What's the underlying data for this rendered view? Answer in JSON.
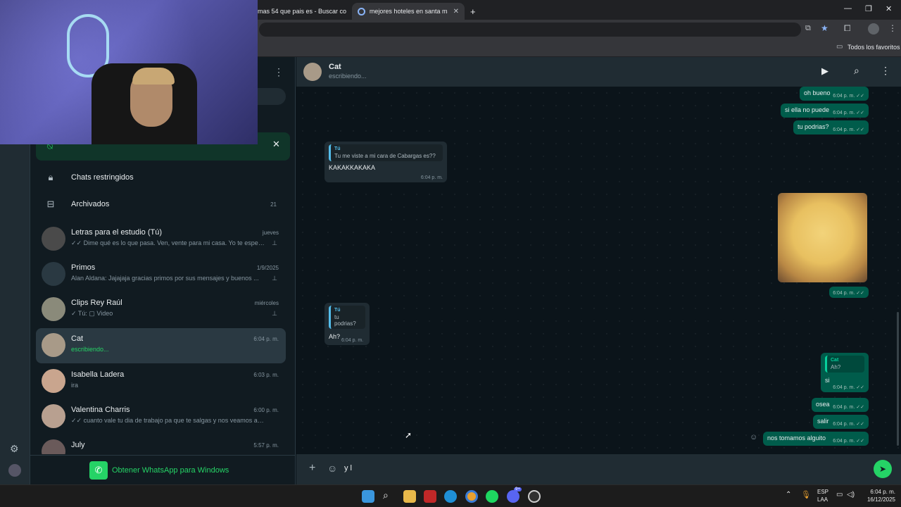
{
  "browser": {
    "tabs": [
      {
        "title": "mas 54 que pais es - Buscar co",
        "close": "✕"
      },
      {
        "title": "mejores hoteles en santa marta",
        "close": "✕"
      }
    ],
    "new_tab": "+",
    "window_controls": [
      "—",
      "❐",
      "✕"
    ],
    "bookmarks_label": "Todos los favoritos"
  },
  "sidebar": {
    "banner_close": "✕",
    "menu": [
      {
        "icon": "lock-icon",
        "label": "Chats restringidos",
        "count": ""
      },
      {
        "icon": "archive-icon",
        "label": "Archivados",
        "count": "21"
      }
    ],
    "chats": [
      {
        "name": "Letras para el estudio (Tú)",
        "time": "jueves",
        "preview": "✓✓ Dime qué es lo que pasa. Ven, vente para mi casa. Yo te esper...",
        "pinned": true
      },
      {
        "name": "Primos",
        "time": "1/9/2025",
        "preview": "Alan Aldana: Jajajaja gracias primos por sus mensajes y buenos ...",
        "pinned": true
      },
      {
        "name": "Clips Rey Raúl",
        "time": "miércoles",
        "preview": "✓ Tú: ▢ Video",
        "pinned": true
      },
      {
        "name": "Cat",
        "time": "6:04 p. m.",
        "preview": "escribiendo...",
        "typing": true
      },
      {
        "name": "Isabella  Ladera",
        "time": "6:03 p. m.",
        "preview": "ira"
      },
      {
        "name": "Valentina Charris",
        "time": "6:00 p. m.",
        "preview": "✓✓ cuanto vale tu dia de trabajo pa que te salgas y nos veamos ahori..."
      },
      {
        "name": "July",
        "time": "5:57 p. m.",
        "preview": ""
      }
    ],
    "get_app": "Obtener WhatsApp para Windows"
  },
  "chat": {
    "contact_name": "Cat",
    "status": "escribiendo...",
    "messages": {
      "m1": {
        "text": "oh bueno",
        "time": "6:04 p. m. ✓✓"
      },
      "m2": {
        "text": "si ella no puede",
        "time": "6:04 p. m. ✓✓"
      },
      "m3": {
        "text": "tu podrias?",
        "time": "6:04 p. m. ✓✓"
      },
      "m4": {
        "quote_author": "Tú",
        "quote_text": "Tu me viste a mi cara de Cabargas es??",
        "text": "KAKAKKAKAKA",
        "time": "6:04 p. m."
      },
      "m5": {
        "time": "6:04 p. m. ✓✓"
      },
      "m6": {
        "quote_author": "Tú",
        "quote_text": "tu podrias?",
        "text": "Ah?",
        "time": "6:04 p. m."
      },
      "m7": {
        "quote_author": "Cat",
        "quote_text": "Ah?",
        "text": "si",
        "time": "6:04 p. m. ✓✓"
      },
      "m8": {
        "text": "osea",
        "time": "6:04 p. m. ✓✓"
      },
      "m9": {
        "text": "salir",
        "time": "6:04 p. m. ✓✓"
      },
      "m10": {
        "text": "nos tomamos alguito",
        "time": "6:04 p. m. ✓✓"
      }
    },
    "composer_text": "y l"
  },
  "taskbar": {
    "lang_top": "ESP",
    "lang_bottom": "LAA",
    "time": "6:04 p. m.",
    "date": "16/12/2025",
    "discord_badge": "9+"
  },
  "colors": {
    "accent": "#25d366",
    "outgoing_bubble": "#005c4b",
    "incoming_bubble": "#202c33"
  }
}
